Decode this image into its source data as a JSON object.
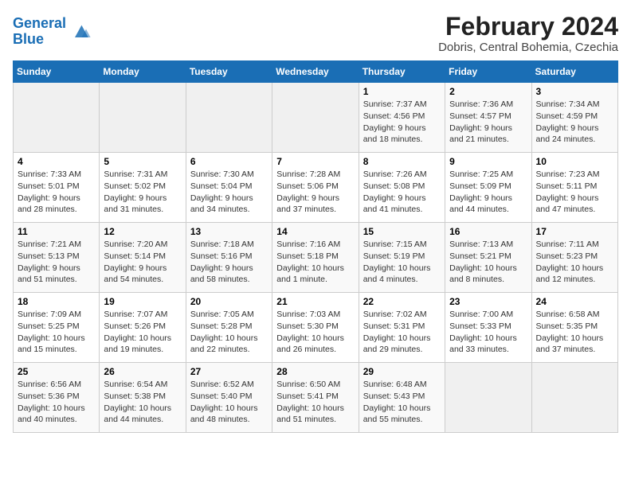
{
  "header": {
    "logo_line1": "General",
    "logo_line2": "Blue",
    "title": "February 2024",
    "subtitle": "Dobris, Central Bohemia, Czechia"
  },
  "weekdays": [
    "Sunday",
    "Monday",
    "Tuesday",
    "Wednesday",
    "Thursday",
    "Friday",
    "Saturday"
  ],
  "weeks": [
    [
      {
        "day": "",
        "content": ""
      },
      {
        "day": "",
        "content": ""
      },
      {
        "day": "",
        "content": ""
      },
      {
        "day": "",
        "content": ""
      },
      {
        "day": "1",
        "content": "Sunrise: 7:37 AM\nSunset: 4:56 PM\nDaylight: 9 hours\nand 18 minutes."
      },
      {
        "day": "2",
        "content": "Sunrise: 7:36 AM\nSunset: 4:57 PM\nDaylight: 9 hours\nand 21 minutes."
      },
      {
        "day": "3",
        "content": "Sunrise: 7:34 AM\nSunset: 4:59 PM\nDaylight: 9 hours\nand 24 minutes."
      }
    ],
    [
      {
        "day": "4",
        "content": "Sunrise: 7:33 AM\nSunset: 5:01 PM\nDaylight: 9 hours\nand 28 minutes."
      },
      {
        "day": "5",
        "content": "Sunrise: 7:31 AM\nSunset: 5:02 PM\nDaylight: 9 hours\nand 31 minutes."
      },
      {
        "day": "6",
        "content": "Sunrise: 7:30 AM\nSunset: 5:04 PM\nDaylight: 9 hours\nand 34 minutes."
      },
      {
        "day": "7",
        "content": "Sunrise: 7:28 AM\nSunset: 5:06 PM\nDaylight: 9 hours\nand 37 minutes."
      },
      {
        "day": "8",
        "content": "Sunrise: 7:26 AM\nSunset: 5:08 PM\nDaylight: 9 hours\nand 41 minutes."
      },
      {
        "day": "9",
        "content": "Sunrise: 7:25 AM\nSunset: 5:09 PM\nDaylight: 9 hours\nand 44 minutes."
      },
      {
        "day": "10",
        "content": "Sunrise: 7:23 AM\nSunset: 5:11 PM\nDaylight: 9 hours\nand 47 minutes."
      }
    ],
    [
      {
        "day": "11",
        "content": "Sunrise: 7:21 AM\nSunset: 5:13 PM\nDaylight: 9 hours\nand 51 minutes."
      },
      {
        "day": "12",
        "content": "Sunrise: 7:20 AM\nSunset: 5:14 PM\nDaylight: 9 hours\nand 54 minutes."
      },
      {
        "day": "13",
        "content": "Sunrise: 7:18 AM\nSunset: 5:16 PM\nDaylight: 9 hours\nand 58 minutes."
      },
      {
        "day": "14",
        "content": "Sunrise: 7:16 AM\nSunset: 5:18 PM\nDaylight: 10 hours\nand 1 minute."
      },
      {
        "day": "15",
        "content": "Sunrise: 7:15 AM\nSunset: 5:19 PM\nDaylight: 10 hours\nand 4 minutes."
      },
      {
        "day": "16",
        "content": "Sunrise: 7:13 AM\nSunset: 5:21 PM\nDaylight: 10 hours\nand 8 minutes."
      },
      {
        "day": "17",
        "content": "Sunrise: 7:11 AM\nSunset: 5:23 PM\nDaylight: 10 hours\nand 12 minutes."
      }
    ],
    [
      {
        "day": "18",
        "content": "Sunrise: 7:09 AM\nSunset: 5:25 PM\nDaylight: 10 hours\nand 15 minutes."
      },
      {
        "day": "19",
        "content": "Sunrise: 7:07 AM\nSunset: 5:26 PM\nDaylight: 10 hours\nand 19 minutes."
      },
      {
        "day": "20",
        "content": "Sunrise: 7:05 AM\nSunset: 5:28 PM\nDaylight: 10 hours\nand 22 minutes."
      },
      {
        "day": "21",
        "content": "Sunrise: 7:03 AM\nSunset: 5:30 PM\nDaylight: 10 hours\nand 26 minutes."
      },
      {
        "day": "22",
        "content": "Sunrise: 7:02 AM\nSunset: 5:31 PM\nDaylight: 10 hours\nand 29 minutes."
      },
      {
        "day": "23",
        "content": "Sunrise: 7:00 AM\nSunset: 5:33 PM\nDaylight: 10 hours\nand 33 minutes."
      },
      {
        "day": "24",
        "content": "Sunrise: 6:58 AM\nSunset: 5:35 PM\nDaylight: 10 hours\nand 37 minutes."
      }
    ],
    [
      {
        "day": "25",
        "content": "Sunrise: 6:56 AM\nSunset: 5:36 PM\nDaylight: 10 hours\nand 40 minutes."
      },
      {
        "day": "26",
        "content": "Sunrise: 6:54 AM\nSunset: 5:38 PM\nDaylight: 10 hours\nand 44 minutes."
      },
      {
        "day": "27",
        "content": "Sunrise: 6:52 AM\nSunset: 5:40 PM\nDaylight: 10 hours\nand 48 minutes."
      },
      {
        "day": "28",
        "content": "Sunrise: 6:50 AM\nSunset: 5:41 PM\nDaylight: 10 hours\nand 51 minutes."
      },
      {
        "day": "29",
        "content": "Sunrise: 6:48 AM\nSunset: 5:43 PM\nDaylight: 10 hours\nand 55 minutes."
      },
      {
        "day": "",
        "content": ""
      },
      {
        "day": "",
        "content": ""
      }
    ]
  ]
}
